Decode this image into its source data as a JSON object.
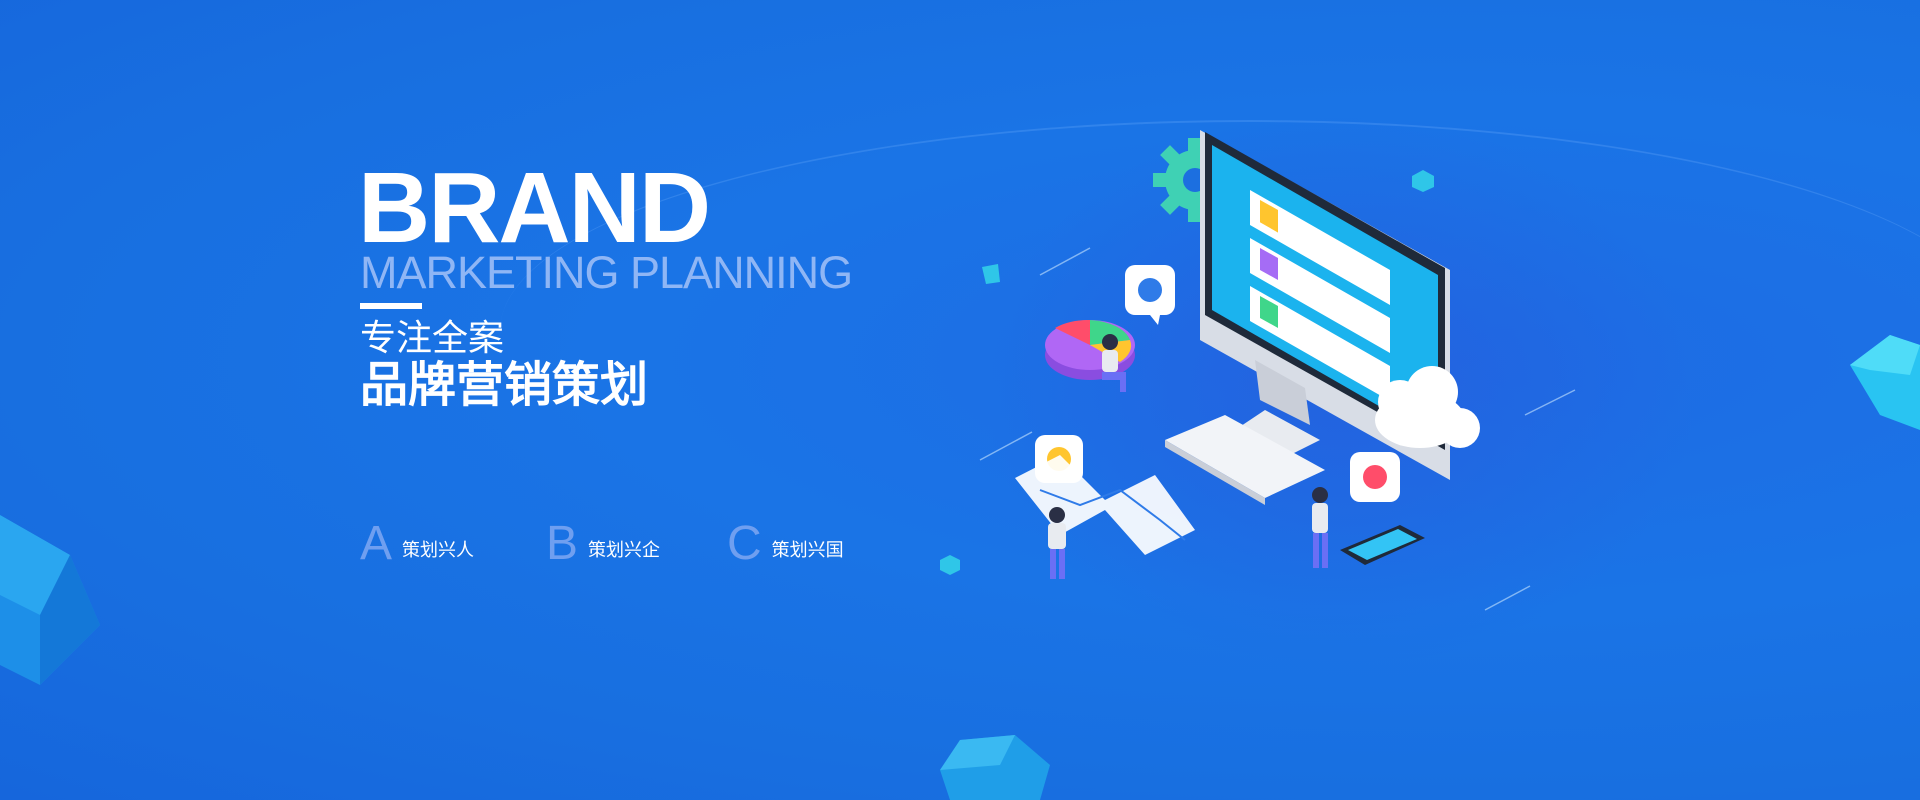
{
  "hero": {
    "brand": "BRAND",
    "subtitle": "MARKETING PLANNING",
    "line1": "专注全案",
    "line2": "品牌营销策划"
  },
  "features": [
    {
      "letter": "A",
      "text": "策划兴人"
    },
    {
      "letter": "B",
      "text": "策划兴企"
    },
    {
      "letter": "C",
      "text": "策划兴国"
    }
  ],
  "colors": {
    "background": "#1a74e6",
    "accent_light": "#8fb6f5",
    "text": "#ffffff"
  },
  "illustration": {
    "icons": [
      "gear-icon",
      "thumbs-up-icon",
      "user-icon",
      "heart-icon",
      "cloud-icon",
      "pie-chart-icon"
    ]
  }
}
